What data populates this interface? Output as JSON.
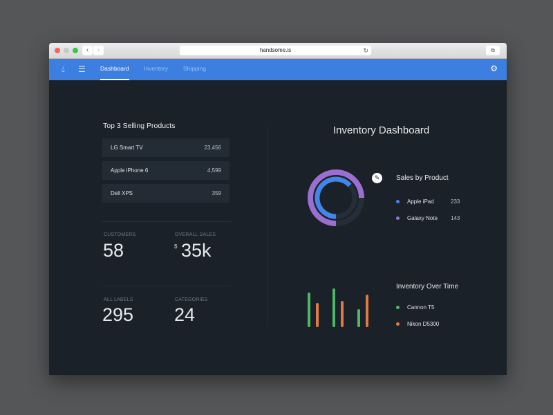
{
  "browser": {
    "url": "handsome.is"
  },
  "nav": {
    "tabs": [
      "Dashboard",
      "Inventory",
      "Shipping"
    ],
    "active": "Dashboard"
  },
  "top_products": {
    "title": "Top 3 Selling Products",
    "items": [
      {
        "name": "LG Smart TV",
        "value": "23,456"
      },
      {
        "name": "Apple iPhone 6",
        "value": "4,599"
      },
      {
        "name": "Dell XPS",
        "value": "359"
      }
    ]
  },
  "stats": {
    "customers_label": "CUSTOMERS",
    "customers": "58",
    "sales_label": "OVERALL SALES",
    "sales_currency": "$",
    "sales": "35k",
    "labels_label": "ALL LABELS",
    "labels": "295",
    "categories_label": "CATEGORIES",
    "categories": "24"
  },
  "dashboard_title": "Inventory Dashboard",
  "sales_by_product": {
    "title": "Sales by Product",
    "items": [
      {
        "name": "Apple iPad",
        "value": "233",
        "color": "#4286ea"
      },
      {
        "name": "Galaxy Note",
        "value": "143",
        "color": "#9a6fcf"
      }
    ]
  },
  "inventory": {
    "title": "Inventory Over Time",
    "series": [
      {
        "name": "Cannon T5",
        "color": "#4fb866",
        "values": [
          46,
          52,
          22
        ]
      },
      {
        "name": "Nikon D5300",
        "color": "#e07a3e",
        "values": [
          31,
          34,
          43
        ]
      }
    ]
  },
  "colors": {
    "nav": "#3c7fe0",
    "bg": "#1b2129"
  }
}
